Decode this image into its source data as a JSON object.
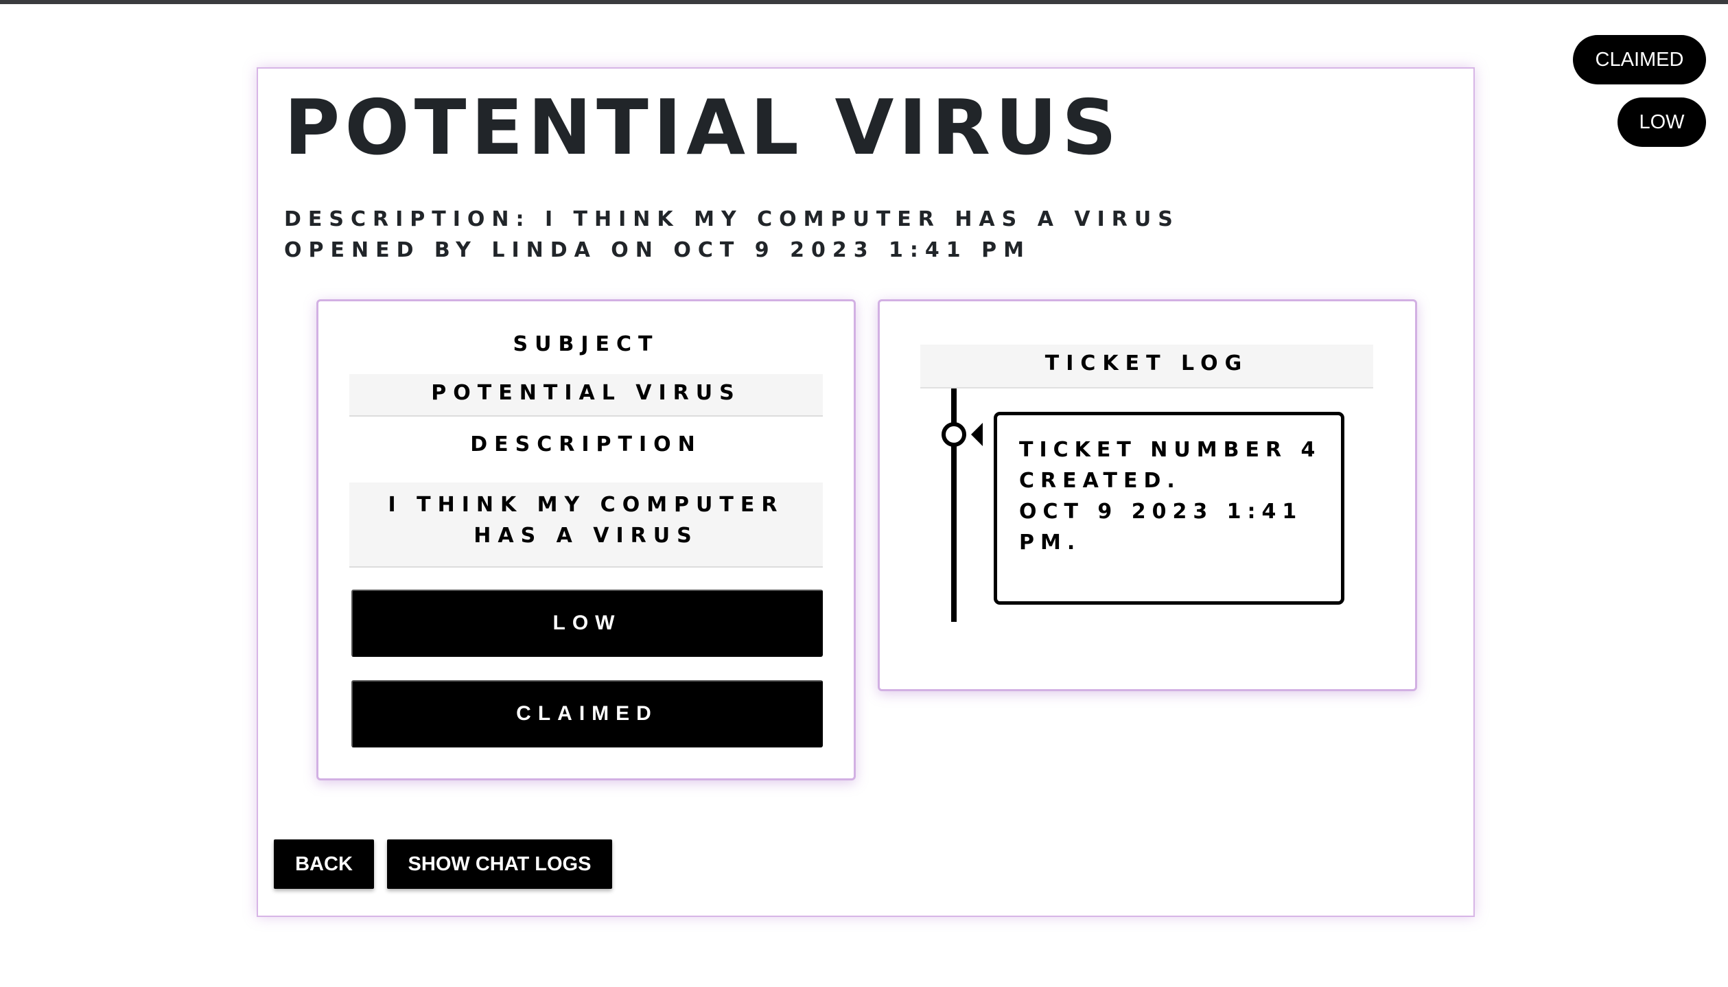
{
  "badges": {
    "status": "CLAIMED",
    "priority": "LOW"
  },
  "ticket": {
    "title": "POTENTIAL VIRUS",
    "description_line": "DESCRIPTION: I THINK MY COMPUTER HAS A VIRUS",
    "opened_line": "OPENED BY LINDA ON OCT 9 2023 1:41 PM"
  },
  "details_panel": {
    "subject_label": "SUBJECT",
    "subject_value": "POTENTIAL VIRUS",
    "description_label": "DESCRIPTION",
    "description_value": "I THINK MY COMPUTER HAS A VIRUS",
    "priority_button": "LOW",
    "status_button": "CLAIMED"
  },
  "ticket_log": {
    "heading": "TICKET LOG",
    "entries": [
      {
        "message": "TICKET NUMBER 4 CREATED.",
        "timestamp": "OCT 9 2023 1:41 PM."
      }
    ]
  },
  "actions": {
    "back": "BACK",
    "show_chat_logs": "SHOW CHAT LOGS"
  },
  "colors": {
    "accent_border": "#d2b0e3",
    "button_bg": "#000000",
    "panel_fill": "#f5f5f5"
  },
  "icons": {
    "timeline_node": "circle-icon",
    "timeline_pointer": "triangle-left-icon"
  }
}
